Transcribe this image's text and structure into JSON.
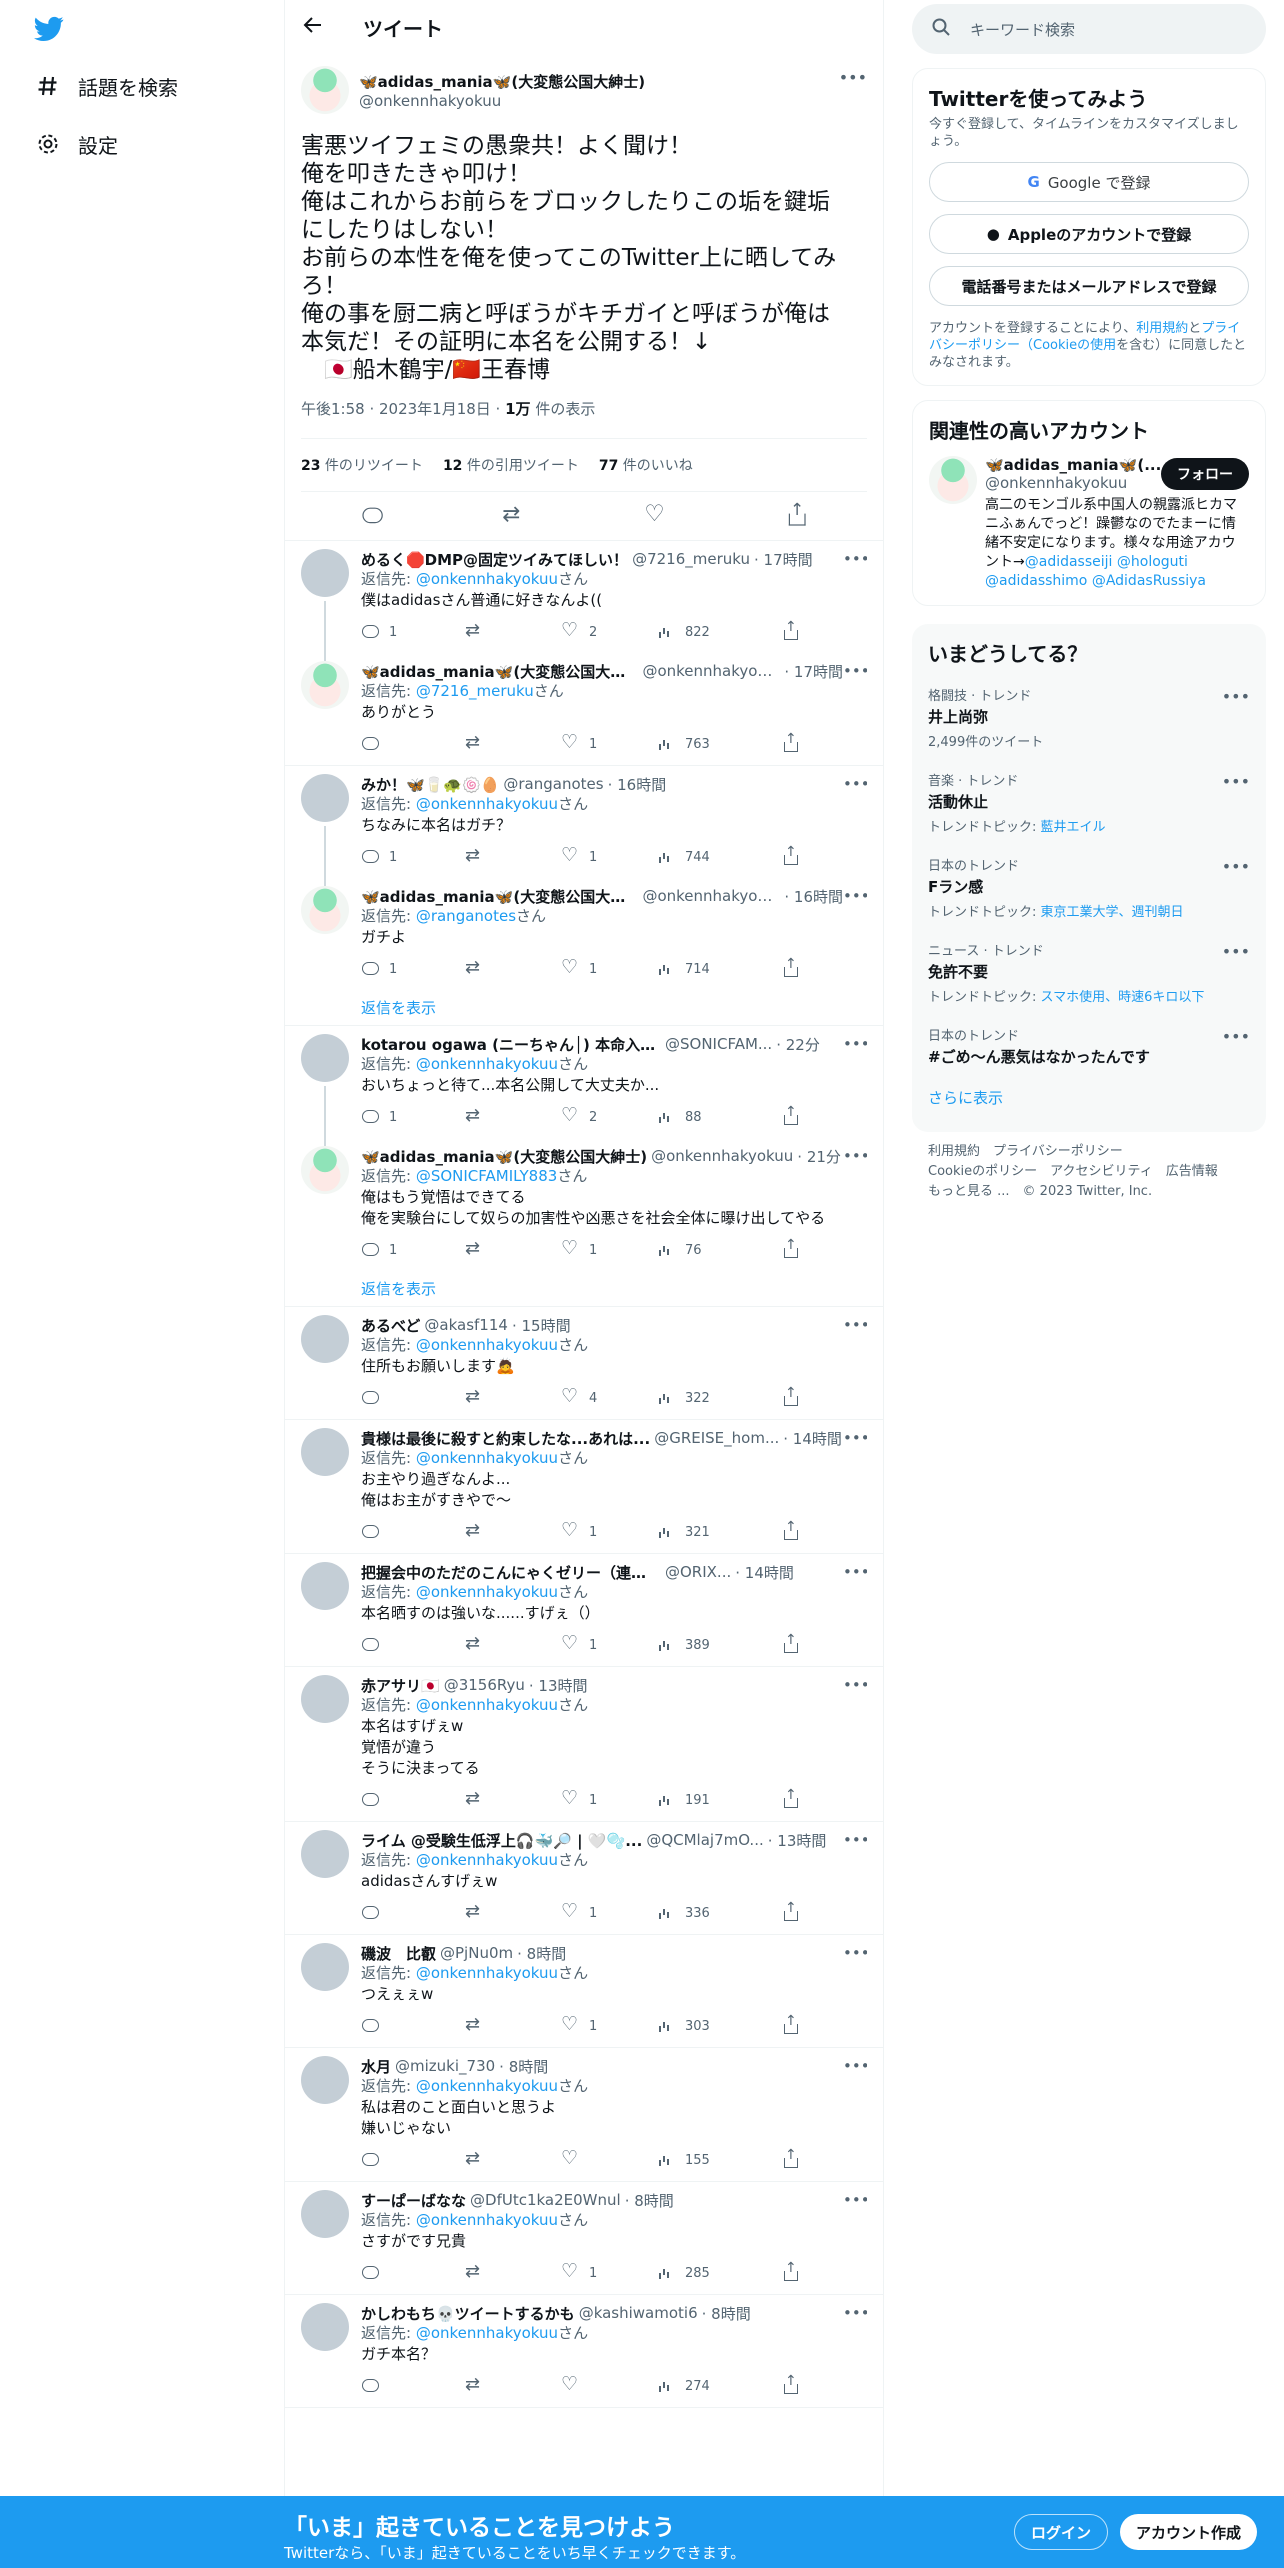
{
  "nav": {
    "explore": "話題を検索",
    "settings": "設定"
  },
  "header": {
    "title": "ツイート"
  },
  "main_tweet": {
    "name": "🦋adidas_mania🦋(大変態公国大紳士)",
    "handle": "@onkennhakyokuu",
    "lines": [
      "害悪ツイフェミの愚衆共！よく聞け！",
      "俺を叩きたきゃ叩け！",
      "俺はこれからお前らをブロックしたりこの垢を鍵垢",
      "にしたりはしない！",
      "お前らの本性を俺を使ってこのTwitter上に晒してみ",
      "ろ！",
      "俺の事を厨二病と呼ぼうがキチガイと呼ぼうが俺は",
      "本気だ！その証明に本名を公開する！↓",
      "　🇯🇵船木鶴宇/🇨🇳王春博"
    ],
    "time": "午後1:58 · 2023年1月18日 · ",
    "views_num": "1万",
    "views_label": " 件の表示",
    "rt_num": "23",
    "rt_label": " 件のリツイート",
    "qt_num": "12",
    "qt_label": " 件の引用ツイート",
    "like_num": "77",
    "like_label": " 件のいいね"
  },
  "reply_prefix": "返信先: ",
  "reply_suffix": "さん",
  "show_replies": "返信を表示",
  "replies": [
    {
      "name": "めるく🛑DMP@固定ツイみてほしい！",
      "handle": "@7216_meruku",
      "time": "· 17時間",
      "to": "@onkennhakyokuu",
      "text": "僕はadidasさん普通に好きなんよ((",
      "c": "1",
      "r": "",
      "l": "2",
      "v": "822",
      "av": "gray"
    },
    {
      "name": "🦋adidas_mania🦋(大変態公国大紳士)",
      "handle": "@onkennhakyokuu",
      "time": "· 17時間",
      "to": "@7216_meruku",
      "text": "ありがとう",
      "c": "",
      "r": "",
      "l": "1",
      "v": "763",
      "av": "anime"
    },
    {
      "name": "みか！🦋🥛🐢🍥🥚",
      "handle": "@ranganotes",
      "time": "· 16時間",
      "to": "@onkennhakyokuu",
      "text": "ちなみに本名はガチ？",
      "c": "1",
      "r": "",
      "l": "1",
      "v": "744",
      "av": "gray"
    },
    {
      "name": "🦋adidas_mania🦋(大変態公国大紳士)",
      "handle": "@onkennhakyokuu",
      "time": "· 16時間",
      "to": "@ranganotes",
      "text": "ガチよ",
      "c": "1",
      "r": "",
      "l": "1",
      "v": "714",
      "av": "anime"
    },
    {
      "name": "kotarou ogawa (ニーちゃん│) 本命入試ま...",
      "handle": "@SONICFAM...",
      "time": "· 22分",
      "to": "@onkennhakyokuu",
      "text": "おいちょっと待て...本名公開して大丈夫か...",
      "c": "1",
      "r": "",
      "l": "2",
      "v": "88",
      "av": "gray"
    },
    {
      "name": "🦋adidas_mania🦋(大変態公国大紳士)",
      "handle": "@onkennhakyokuu",
      "time": "· 21分",
      "to": "@SONICFAMILY883",
      "text": "俺はもう覚悟はできてる\n俺を実験台にして奴らの加害性や凶悪さを社会全体に曝け出してやる",
      "c": "1",
      "r": "",
      "l": "1",
      "v": "76",
      "av": "anime"
    },
    {
      "name": "あるべど",
      "handle": "@akasf114",
      "time": "· 15時間",
      "to": "@onkennhakyokuu",
      "text": "住所もお願いします🙇",
      "c": "",
      "r": "",
      "l": "4",
      "v": "322",
      "av": "gray"
    },
    {
      "name": "貴様は最後に殺すと約束したな...あれは...",
      "handle": "@GREISE_hom...",
      "time": "· 14時間",
      "to": "@onkennhakyokuu",
      "text": "お主やり過ぎなんよ...\n俺はお主がすきやで〜",
      "c": "",
      "r": "",
      "l": "1",
      "v": "321",
      "av": "gray"
    },
    {
      "name": "把握会中のただのこんにゃくゼリー（連敗街道...",
      "handle": "@ORIX...",
      "time": "· 14時間",
      "to": "@onkennhakyokuu",
      "text": "本名晒すのは強いな......すげぇ（）",
      "c": "",
      "r": "",
      "l": "1",
      "v": "389",
      "av": "gray"
    },
    {
      "name": "赤アサリ🇯🇵",
      "handle": "@3156Ryu",
      "time": "· 13時間",
      "to": "@onkennhakyokuu",
      "text": "本名はすげぇw\n覚悟が違う\nそうに決まってる",
      "c": "",
      "r": "",
      "l": "1",
      "v": "191",
      "av": "gray"
    },
    {
      "name": "ライム @受験生低浮上🎧🐳🔎 | 🤍🫧...",
      "handle": "@QCMlaj7mO...",
      "time": "· 13時間",
      "to": "@onkennhakyokuu",
      "text": "adidasさんすげぇw",
      "c": "",
      "r": "",
      "l": "1",
      "v": "336",
      "av": "gray"
    },
    {
      "name": "磯波　比叡",
      "handle": "@PjNu0m",
      "time": "· 8時間",
      "to": "@onkennhakyokuu",
      "text": "つえぇぇw",
      "c": "",
      "r": "",
      "l": "1",
      "v": "303",
      "av": "gray"
    },
    {
      "name": "水月",
      "handle": "@mizuki_730",
      "time": "· 8時間",
      "to": "@onkennhakyokuu",
      "text": "私は君のこと面白いと思うよ\n嫌いじゃない",
      "c": "",
      "r": "",
      "l": "",
      "v": "155",
      "av": "gray"
    },
    {
      "name": "すーぱーばなな",
      "handle": "@DfUtc1ka2E0Wnul",
      "time": "· 8時間",
      "to": "@onkennhakyokuu",
      "text": "さすがです兄貴",
      "c": "",
      "r": "",
      "l": "1",
      "v": "285",
      "av": "gray"
    },
    {
      "name": "かしわもち💀ツイートするかも",
      "handle": "@kashiwamoti6",
      "time": "· 8時間",
      "to": "@onkennhakyokuu",
      "text": "ガチ本名？",
      "c": "",
      "r": "",
      "l": "",
      "v": "274",
      "av": "gray"
    }
  ],
  "search": {
    "placeholder": "キーワード検索"
  },
  "signup": {
    "title": "Twitterを使ってみよう",
    "desc": "今すぐ登録して、タイムラインをカスタマイズしましょう。",
    "google": "Google で登録",
    "apple": "Appleのアカウントで登録",
    "phone": "電話番号またはメールアドレスで登録",
    "terms_1": "アカウントを登録することにより、",
    "terms_link1": "利用規約",
    "terms_2": "と",
    "terms_link2": "プライバシーポリシー（Cookieの使用",
    "terms_3": "を含む）に同意したとみなされます。"
  },
  "related": {
    "title": "関連性の高いアカウント",
    "name": "🦋adidas_mania🦋(...",
    "handle": "@onkennhakyokuu",
    "follow": "フォロー",
    "bio": "高二のモンゴル系中国人の親露派ヒカマニふぁんでっど！躁鬱なのでたまーに情緒不安定になります。様々な用途アカウント→",
    "bio_links": "@adidasseiji @hologuti @adidasshimo @AdidasRussiya"
  },
  "trends": {
    "title": "いまどうしてる？",
    "items": [
      {
        "cat": "格闘技 · トレンド",
        "title": "井上尚弥",
        "sub": "2,499件のツイート",
        "sub_link": ""
      },
      {
        "cat": "音楽 · トレンド",
        "title": "活動休止",
        "sub": "トレンドトピック: ",
        "sub_link": "藍井エイル"
      },
      {
        "cat": "日本のトレンド",
        "title": "Fラン感",
        "sub": "トレンドトピック: ",
        "sub_link": "東京工業大学、週刊朝日"
      },
      {
        "cat": "ニュース · トレンド",
        "title": "免許不要",
        "sub": "トレンドトピック: ",
        "sub_link": "スマホ使用、時速6キロ以下"
      },
      {
        "cat": "日本のトレンド",
        "title": "#ごめ〜ん悪気はなかったんです",
        "sub": "",
        "sub_link": ""
      }
    ],
    "more": "さらに表示"
  },
  "footer": {
    "l1": "利用規約",
    "l2": "プライバシーポリシー",
    "l3": "Cookieのポリシー",
    "l4": "アクセシビリティ",
    "l5": "広告情報",
    "l6": "もっと見る ...",
    "copy": "© 2023 Twitter, Inc."
  },
  "bottom": {
    "title": "「いま」起きていることを見つけよう",
    "sub": "Twitterなら、「いま」起きていることをいち早くチェックできます。",
    "login": "ログイン",
    "signup": "アカウント作成"
  },
  "colors": {
    "accent": "#1d9bf0",
    "text": "#0f1419",
    "muted": "#536471"
  }
}
